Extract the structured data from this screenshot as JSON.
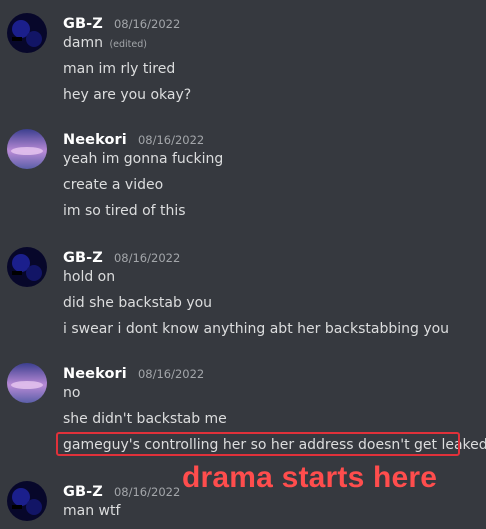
{
  "messages": [
    {
      "author": "GB-Z",
      "timestamp": "08/16/2022",
      "avatar": "dark-blue-avatar",
      "lines": [
        "damn",
        "man im rly tired",
        "hey are you okay?"
      ],
      "edited_label": "(edited)"
    },
    {
      "author": "Neekori",
      "timestamp": "08/16/2022",
      "avatar": "purple-sky-avatar",
      "lines": [
        "yeah im gonna fucking",
        "create a video",
        "im so tired of this"
      ]
    },
    {
      "author": "GB-Z",
      "timestamp": "08/16/2022",
      "avatar": "dark-blue-avatar",
      "lines": [
        "hold on",
        "did she backstab you",
        "i swear i dont know anything abt her backstabbing you"
      ]
    },
    {
      "author": "Neekori",
      "timestamp": "08/16/2022",
      "avatar": "purple-sky-avatar",
      "lines": [
        "no",
        "she didn't backstab me",
        "gameguy's controlling her so her address doesn't get leaked"
      ]
    },
    {
      "author": "GB-Z",
      "timestamp": "08/16/2022",
      "avatar": "dark-blue-avatar",
      "lines": [
        "man wtf"
      ]
    }
  ],
  "annotation": {
    "text": "drama starts here",
    "color": "#ff4d4d"
  },
  "colors": {
    "background": "#36393f",
    "text": "#dcddde",
    "author": "#ffffff",
    "muted": "#a3a6aa",
    "highlight_border": "#e0313a"
  }
}
